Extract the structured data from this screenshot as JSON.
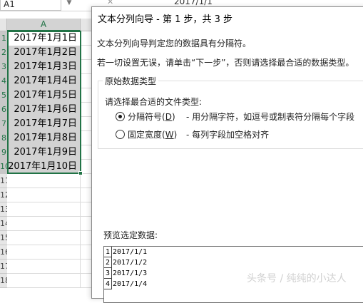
{
  "excel": {
    "name_box": "A1",
    "formula_icon_x": "✕",
    "formula_value": "2017/1/1",
    "column_header_a": "A",
    "rows": [
      {
        "row": "1",
        "value": "2017年1月1日"
      },
      {
        "row": "2",
        "value": "2017年1月2日"
      },
      {
        "row": "3",
        "value": "2017年1月3日"
      },
      {
        "row": "4",
        "value": "2017年1月4日"
      },
      {
        "row": "5",
        "value": "2017年1月5日"
      },
      {
        "row": "6",
        "value": "2017年1月6日"
      },
      {
        "row": "7",
        "value": "2017年1月7日"
      },
      {
        "row": "8",
        "value": "2017年1月8日"
      },
      {
        "row": "9",
        "value": "2017年1月9日"
      },
      {
        "row": "10",
        "value": "2017年1月10日"
      },
      {
        "row": "11",
        "value": ""
      },
      {
        "row": "12",
        "value": ""
      },
      {
        "row": "13",
        "value": ""
      },
      {
        "row": "14",
        "value": ""
      },
      {
        "row": "15",
        "value": ""
      },
      {
        "row": "16",
        "value": ""
      },
      {
        "row": "17",
        "value": ""
      },
      {
        "row": "18",
        "value": ""
      }
    ]
  },
  "dialog": {
    "title": "文本分列向导 - 第 1 步，共 3 步",
    "desc1": "文本分列向导判定您的数据具有分隔符。",
    "desc2": "若一切设置无误，请单击“下一步”，否则请选择最合适的数据类型。",
    "group_title": "原始数据类型",
    "filetype_label": "请选择最合适的文件类型:",
    "radio_delimited": {
      "label": "分隔符号(",
      "accel": "D",
      "label_end": ")",
      "desc": "- 用分隔字符，如逗号或制表符分隔每个字段",
      "checked": true
    },
    "radio_fixed": {
      "label": "固定宽度(",
      "accel": "W",
      "label_end": ")",
      "desc": "- 每列字段加空格对齐",
      "checked": false
    },
    "preview_label": "预览选定数据:",
    "preview_rows": [
      {
        "num": "1",
        "text": "2017/1/1"
      },
      {
        "num": "2",
        "text": "2017/1/2"
      },
      {
        "num": "3",
        "text": "2017/1/3"
      },
      {
        "num": "4",
        "text": "2017/1/4"
      }
    ]
  },
  "watermark": "头条号 / 纯纯的小达人"
}
